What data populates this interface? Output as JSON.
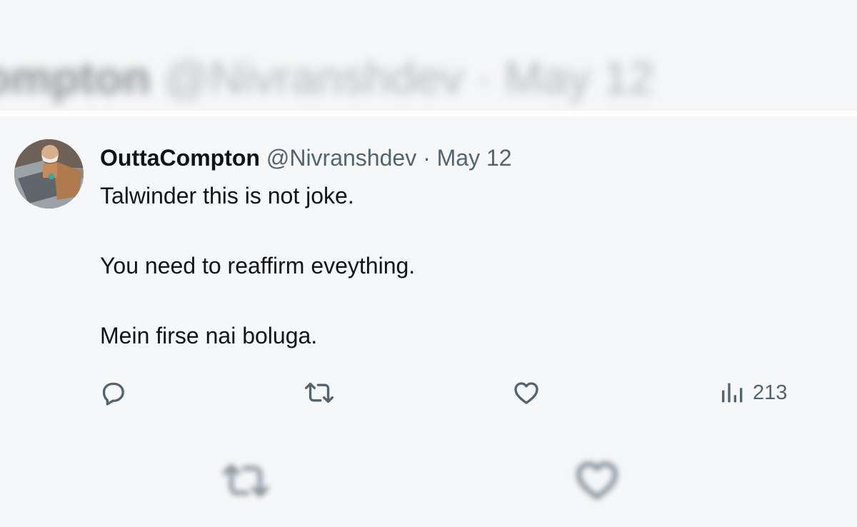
{
  "blurred_header": {
    "name": "Compton",
    "handle": "@Nivranshdev",
    "separator": "·",
    "date": "May 12"
  },
  "tweet": {
    "display_name": "OuttaCompton",
    "handle": "@Nivranshdev",
    "separator": "·",
    "date": "May 12",
    "lines": [
      "Talwinder this is not joke.",
      "You need to reaffirm eveything.",
      "Mein firse nai boluga."
    ],
    "actions": {
      "reply_icon": "reply-bubble-icon",
      "retweet_icon": "retweet-arrows-icon",
      "like_icon": "heart-icon",
      "views_icon": "bar-chart-icon",
      "views_count": "213"
    }
  },
  "colors": {
    "text_primary": "#0f1419",
    "text_secondary": "#536471",
    "background": "#f6f7f8"
  }
}
